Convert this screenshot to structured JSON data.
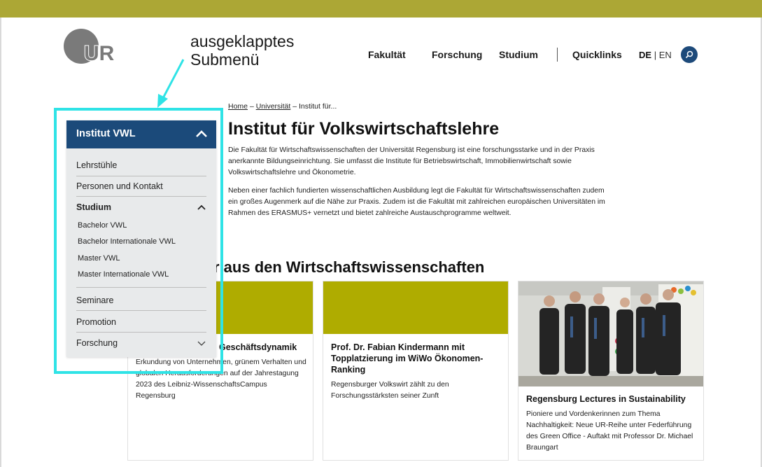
{
  "annotation": {
    "line1": "ausgeklapptes",
    "line2": "Submenü"
  },
  "logo": {
    "text": "UR"
  },
  "nav": {
    "items": [
      "Fakultät",
      "Forschung",
      "Studium",
      "Quicklinks"
    ],
    "lang_de": "DE",
    "lang_sep": "|",
    "lang_en": "EN"
  },
  "breadcrumb": {
    "home": "Home",
    "sep1": "–",
    "universitaet": "Universität",
    "sep2": "–",
    "current": "Institut für..."
  },
  "page_title": "Institut für Volkswirtschaftslehre",
  "intro": {
    "p1": "Die Fakultät für Wirtschaftswissenschaften der Universität Regensburg ist eine forschungsstarke und in der Praxis anerkannte Bildungseinrichtung. Sie umfasst die Institute für Betriebswirtschaft, Immobilienwirtschaft sowie Volkswirtschaftslehre und Ökonometrie.",
    "p2": "Neben einer fachlich fundierten wissenschaftlichen Ausbildung legt die Fakultät für Wirtschaftswissenschaften zudem ein großes Augenmerk auf die Nähe zur Praxis. Zudem ist die Fakultät mit zahlreichen europäischen Universitäten im Rahmen des ERASMUS+ vernetzt und bietet zahlreiche Austauschprogramme weltweit."
  },
  "section_title": "r aus den Wirtschaftswissenschaften",
  "cards": [
    {
      "title": "Geschäftsdynamik",
      "text": "Erkundung von Unternehmen, grünem Verhalten und globalen Herausforderungen auf der Jahrestagung 2023 des Leibniz-WissenschaftsCampus Regensburg"
    },
    {
      "title": "Prof. Dr. Fabian Kindermann mit Topplatzierung im WiWo Ökonomen-Ranking",
      "text": "Regensburger Volkswirt zählt zu den Forschungsstärksten seiner Zunft"
    },
    {
      "title": "Regensburg Lectures in Sustainability",
      "text": "Pioniere und Vordenkerinnen zum Thema Nachhaltigkeit: Neue UR-Reihe unter Federführung des Green Office - Auftakt mit Professor Dr. Michael Braungart"
    }
  ],
  "menu": {
    "header": "Institut VWL",
    "items": {
      "lehrstuehle": "Lehrstühle",
      "personen": "Personen und Kontakt",
      "studium": "Studium",
      "seminare": "Seminare",
      "promotion": "Promotion",
      "forschung": "Forschung"
    },
    "studium_sub": [
      "Bachelor VWL",
      "Bachelor Internationale VWL",
      "Master VWL",
      "Master Internationale VWL"
    ]
  },
  "colors": {
    "topbar": "#aca735",
    "menu_header": "#1b4a7a",
    "card_image": "#afac00",
    "highlight": "#2fe3e6"
  }
}
